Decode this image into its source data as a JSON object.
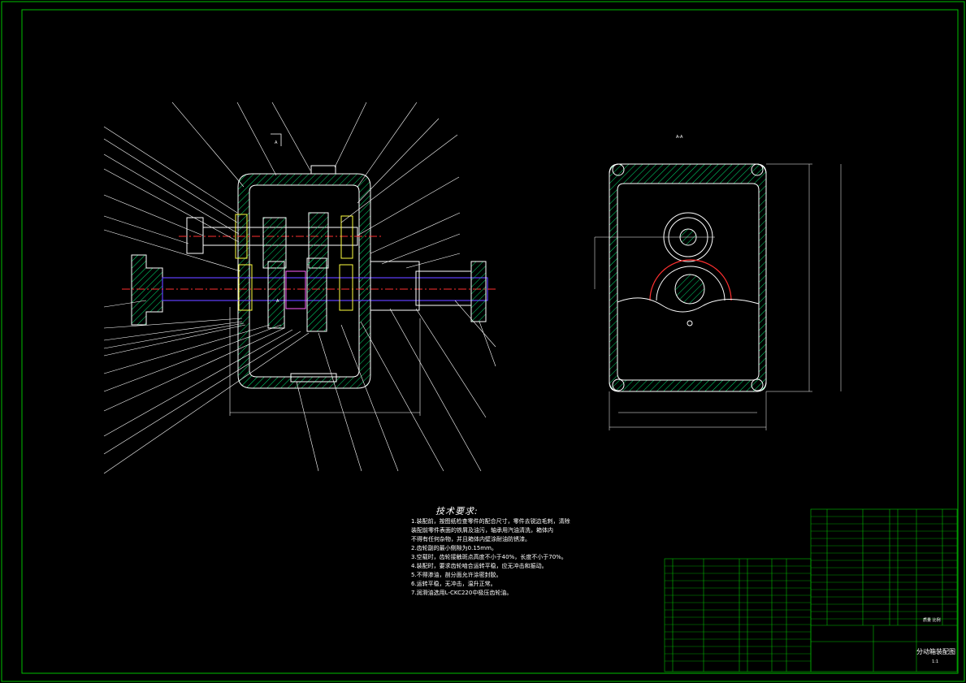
{
  "drawing": {
    "type": "cad-assembly-drawing",
    "colors": {
      "background": "#000000",
      "frame": "#00c000",
      "outline": "#ffffff",
      "hatch": "#00e070",
      "centerline": "#ff3030",
      "shaft": "#6040ff",
      "seal": "#ff60ff",
      "bearing": "#ffff40",
      "leader": "#ffffff"
    },
    "section_label": "A-A",
    "view_marker": "A"
  },
  "tech_requirements": {
    "title": "技术要求:",
    "lines": [
      "1.装配前，按图纸检查零件的配合尺寸，零件去锐边毛刺，清除",
      "  装配前零件表面的铁屑及油污，轴承用汽油清洗，箱体内",
      "  不得有任何杂物，并且箱体内壁涂耐油防锈漆。",
      "2.齿轮副的最小侧隙为0.15mm。",
      "3.空载时，齿轮接触斑点高度不小于40%，长度不小于70%。",
      "4.装配时，要求齿轮啮合运转平稳，应无冲击和振动。",
      "5.不得渗油，剖分面允许涂密封胶。",
      "6.运转平稳，无冲击，温升正常。",
      "7.润滑油选用L-CKC220中极压齿轮油。"
    ]
  },
  "title_block": {
    "drawing_name": "分动箱装配图",
    "scale": "1:1",
    "grade_note": "质量 比例"
  }
}
